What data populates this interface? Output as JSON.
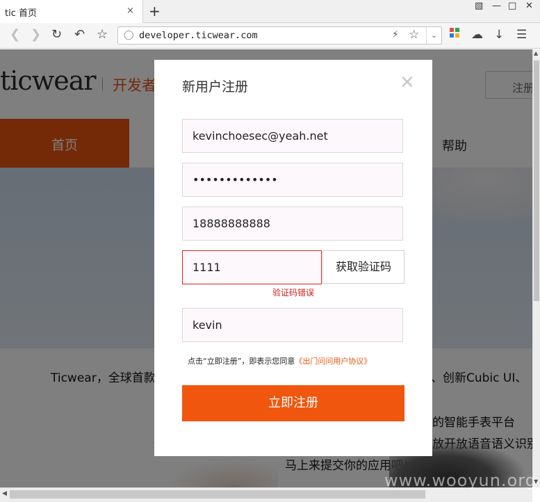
{
  "browser": {
    "tab_title": "tic 首页",
    "tab_close": "×",
    "new_tab": "+",
    "url": "developer.ticwear.com"
  },
  "page": {
    "logo": "ticwear",
    "logo_sub": "开发者",
    "login_label": "注册",
    "nav": {
      "home": "首页",
      "help": "帮助"
    },
    "intro_line1_left": "Ticwear，全球首款",
    "intro_line1_right": "、创新Cubic UI、",
    "intro_line2_right": "的智能手表平台",
    "intro_line3_left": "通",
    "intro_line3_right": "放开放语音语义识别",
    "intro_line4": "马上来提交你的应用吧！"
  },
  "watermark": "www.wooyun.org",
  "modal": {
    "title": "新用户注册",
    "close": "✕",
    "email_value": "kevinchoesec@yeah.net",
    "password_value": "•••••••••••••",
    "phone_value": "18888888888",
    "code_value": "1111",
    "code_button": "获取验证码",
    "code_error": "验证码错误",
    "nickname_value": "kevin",
    "agree_prefix": "点击“立即注册”，即表示您同意",
    "agree_link": "《出门问问用户协议》",
    "submit_label": "立即注册"
  },
  "colors": {
    "accent": "#f0560d",
    "error": "#d8281e"
  }
}
